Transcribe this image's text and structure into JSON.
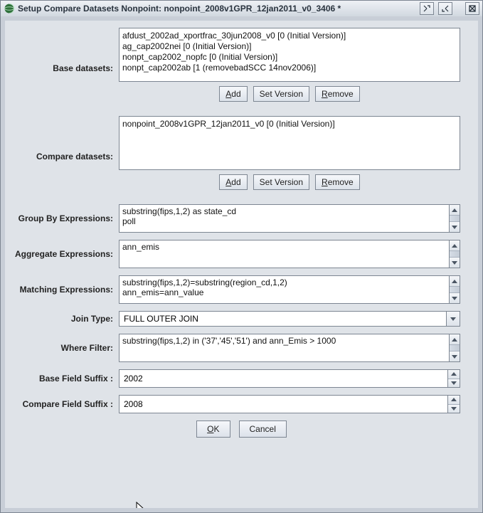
{
  "window": {
    "title": "Setup Compare Datasets Nonpoint: nonpoint_2008v1GPR_12jan2011_v0_3406 *"
  },
  "labels": {
    "baseDatasets": "Base datasets:",
    "compareDatasets": "Compare datasets:",
    "groupBy": "Group By Expressions:",
    "aggregate": "Aggregate Expressions:",
    "matching": "Matching Expressions:",
    "joinType": "Join Type:",
    "whereFilter": "Where Filter:",
    "baseSuffix": "Base Field Suffix :",
    "compareSuffix": "Compare Field Suffix :"
  },
  "baseList": [
    "afdust_2002ad_xportfrac_30jun2008_v0 [0 (Initial Version)]",
    "ag_cap2002nei [0 (Initial Version)]",
    "nonpt_cap2002_nopfc [0 (Initial Version)]",
    "nonpt_cap2002ab [1 (removebadSCC 14nov2006)]"
  ],
  "compareList": [
    "nonpoint_2008v1GPR_12jan2011_v0 [0 (Initial Version)]"
  ],
  "buttons": {
    "add": "dd",
    "addPrefix": "A",
    "setVersion": "Set Version",
    "remove": "emove",
    "removePrefix": "R",
    "ok": "K",
    "okPrefix": "O",
    "cancel": "Cancel"
  },
  "values": {
    "groupBy": "substring(fips,1,2) as state_cd\npoll",
    "aggregate": "ann_emis",
    "matching": "substring(fips,1,2)=substring(region_cd,1,2)\nann_emis=ann_value",
    "joinType": "FULL OUTER JOIN",
    "whereFilter": "substring(fips,1,2) in ('37','45','51') and ann_Emis > 1000",
    "baseSuffix": "2002",
    "compareSuffix": "2008"
  }
}
